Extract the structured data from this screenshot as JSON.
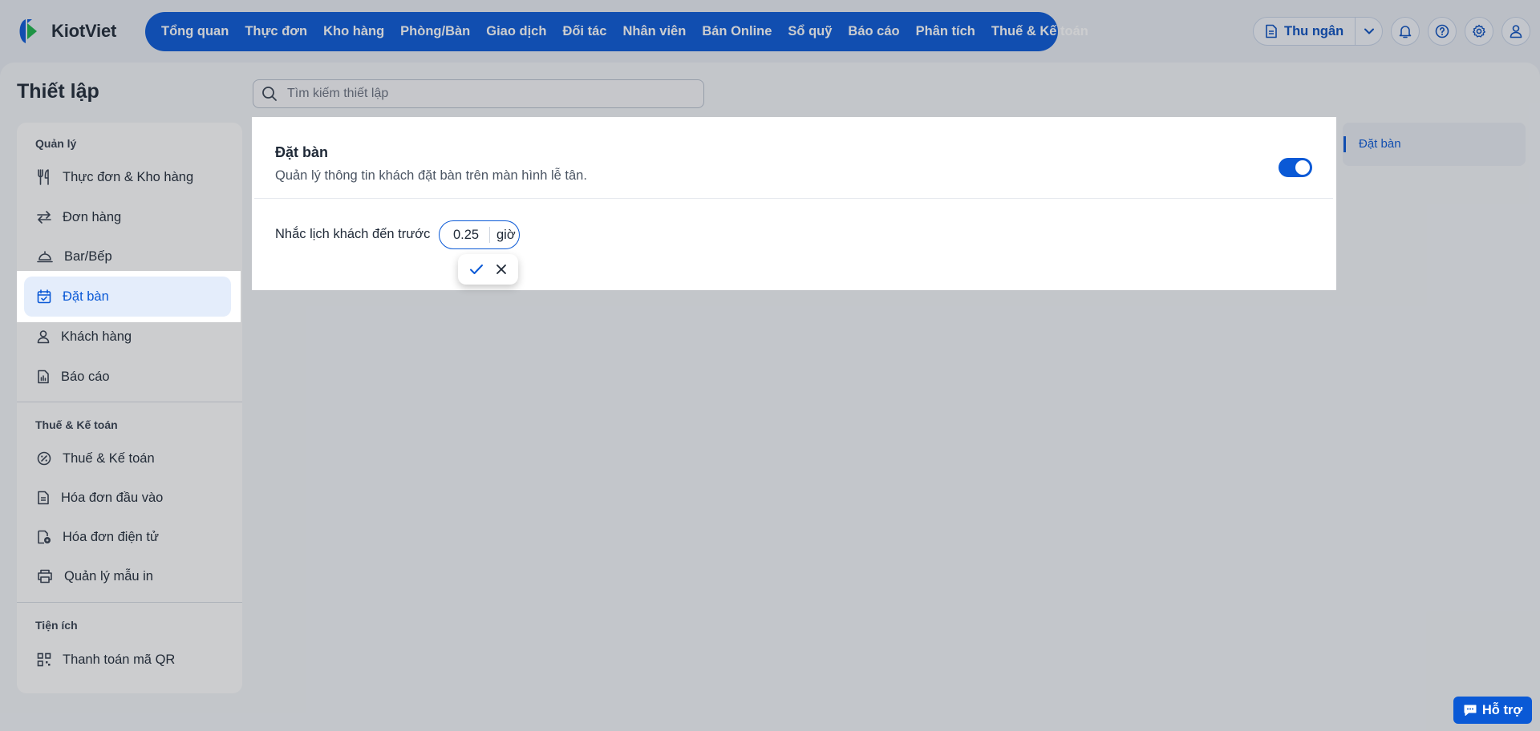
{
  "brand": {
    "name": "KiotViet",
    "blue": "#0a59d6",
    "green": "#1bb34a"
  },
  "nav": {
    "items": [
      "Tổng quan",
      "Thực đơn",
      "Kho hàng",
      "Phòng/Bàn",
      "Giao dịch",
      "Đối tác",
      "Nhân viên",
      "Bán Online",
      "Sổ quỹ",
      "Báo cáo",
      "Phân tích",
      "Thuế & Kế toán"
    ]
  },
  "tools": {
    "cashier_label": "Thu ngân"
  },
  "page": {
    "title": "Thiết lập",
    "search_placeholder": "Tìm kiếm thiết lập"
  },
  "sidebar": {
    "sections": [
      {
        "title": "Quản lý",
        "items": [
          "Thực đơn & Kho hàng",
          "Đơn hàng",
          "Bar/Bếp",
          "Đặt bàn",
          "Khách hàng",
          "Báo cáo"
        ]
      },
      {
        "title": "Thuế & Kế toán",
        "items": [
          "Thuế & Kế toán",
          "Hóa đơn đầu vào",
          "Hóa đơn điện tử",
          "Quản lý mẫu in"
        ]
      },
      {
        "title": "Tiện ích",
        "items": [
          "Thanh toán mã QR"
        ]
      }
    ],
    "active": "Đặt bàn"
  },
  "anchor": {
    "label": "Đặt bàn"
  },
  "card": {
    "title": "Đặt bàn",
    "subtitle": "Quản lý thông tin khách đặt bàn trên màn hình lễ tân.",
    "enabled": true,
    "remind_label": "Nhắc lịch khách đến trước",
    "remind_value": "0.25",
    "remind_unit": "giờ"
  },
  "support": {
    "label": "Hỗ trợ"
  }
}
